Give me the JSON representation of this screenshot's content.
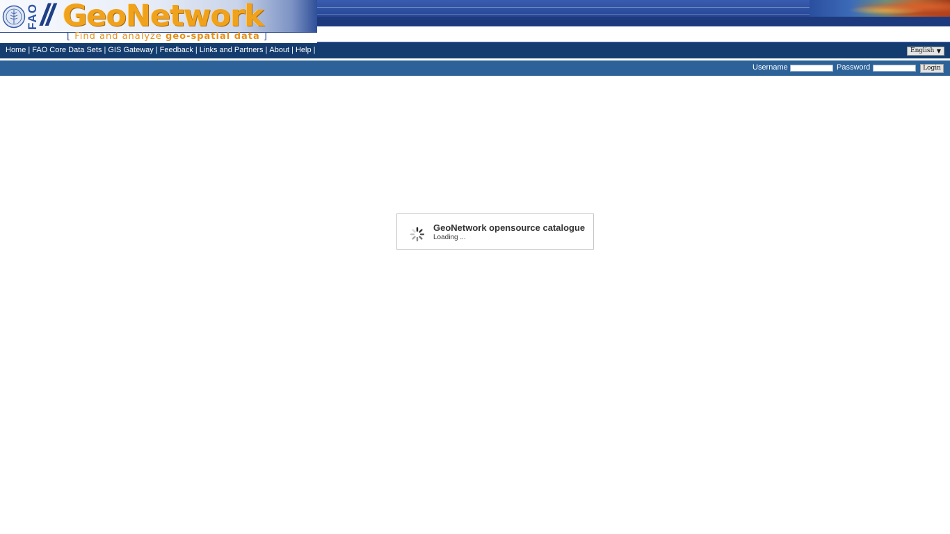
{
  "banner": {
    "org_label": "FAO",
    "logo_slashes": "//",
    "logo_text": "GeoNetwork",
    "tagline_bracket_open": "[",
    "tagline_plain": "Find and analyze",
    "tagline_bold": "geo-spatial data",
    "tagline_bracket_close": "]"
  },
  "nav": {
    "links": [
      {
        "label": "Home"
      },
      {
        "label": "FAO Core Data Sets"
      },
      {
        "label": "GIS Gateway"
      },
      {
        "label": "Feedback"
      },
      {
        "label": "Links and Partners"
      },
      {
        "label": "About"
      },
      {
        "label": "Help"
      }
    ],
    "separator": "|",
    "language": {
      "selected": "English",
      "arrow": "▼"
    }
  },
  "login": {
    "username_label": "Username",
    "username_value": "",
    "password_label": "Password",
    "password_value": "",
    "button_label": "Login"
  },
  "loading": {
    "title": "GeoNetwork opensource catalogue",
    "message": "Loading ..."
  },
  "colors": {
    "nav_bar": "#143c6e",
    "login_bar": "#2d6299",
    "logo_orange": "#f0a21c",
    "banner_blue": "#1f3f86"
  },
  "icons": {
    "emblem": "fao-emblem-icon",
    "spinner": "loading-spinner-icon",
    "dropdown": "chevron-down-icon"
  }
}
